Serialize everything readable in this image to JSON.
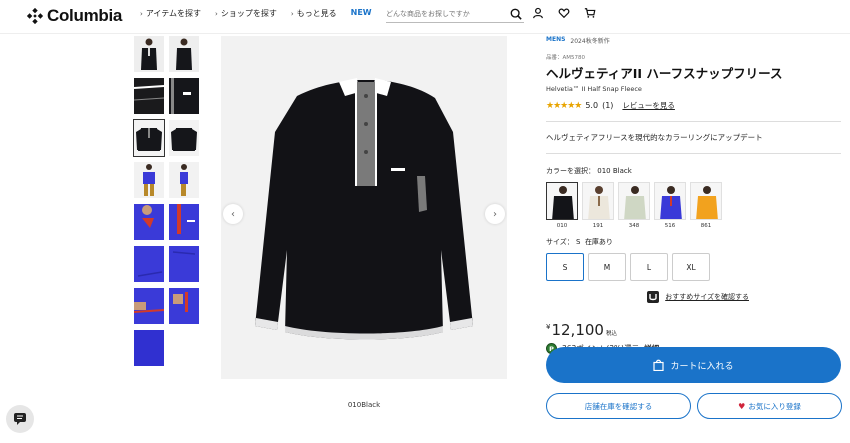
{
  "header": {
    "brand": "Columbia",
    "nav": [
      {
        "label": "アイテムを探す"
      },
      {
        "label": "ショップを探す"
      },
      {
        "label": "もっと見る"
      }
    ],
    "nav_new": "NEW",
    "search_placeholder": "どんな商品をお探しですか"
  },
  "gallery": {
    "caption": "010Black",
    "colors": {
      "black": "#121216",
      "accent": "#ffffff",
      "gray": "#7a7a7a",
      "blue": "#3a3ad8",
      "red": "#d23a2a"
    }
  },
  "product": {
    "category": "MENS",
    "season": "2024秋冬新作",
    "sku": "品番：AM5780",
    "title": "ヘルヴェティアII ハーフスナップフリース",
    "subtitle": "Helvetia™ II Half Snap Fleece",
    "rating_value": "5.0",
    "rating_count": "(1)",
    "stars": 5,
    "review_link": "レビューを見る",
    "tagline": "ヘルヴェティアフリースを現代的なカラーリングにアップデート",
    "color_label": "カラーを選択：",
    "color_selected": "010 Black",
    "swatches": [
      {
        "code": "010",
        "color": "#131418",
        "selected": true
      },
      {
        "code": "191",
        "color": "#ece7dc",
        "selected": false
      },
      {
        "code": "348",
        "color": "#cfd7c4",
        "selected": false
      },
      {
        "code": "516",
        "color": "#3a3ad8",
        "selected": false
      },
      {
        "code": "861",
        "color": "#f2a21e",
        "selected": false
      }
    ],
    "size_label": "サイズ：",
    "size_selected": "S",
    "stock_status": "在庫あり",
    "sizes": [
      {
        "label": "S",
        "selected": true
      },
      {
        "label": "M",
        "selected": false
      },
      {
        "label": "L",
        "selected": false
      },
      {
        "label": "XL",
        "selected": false
      }
    ],
    "size_guide": "おすすめサイズを確認する",
    "currency": "¥",
    "price": "12,100",
    "tax_label": "税込",
    "points_badge": "P",
    "points_text": "363ポイント(3%)還元",
    "points_detail": "詳細",
    "cart_button": "カートに入れる",
    "store_button": "店舗在庫を確認する",
    "fav_button": "お気に入り登録"
  }
}
